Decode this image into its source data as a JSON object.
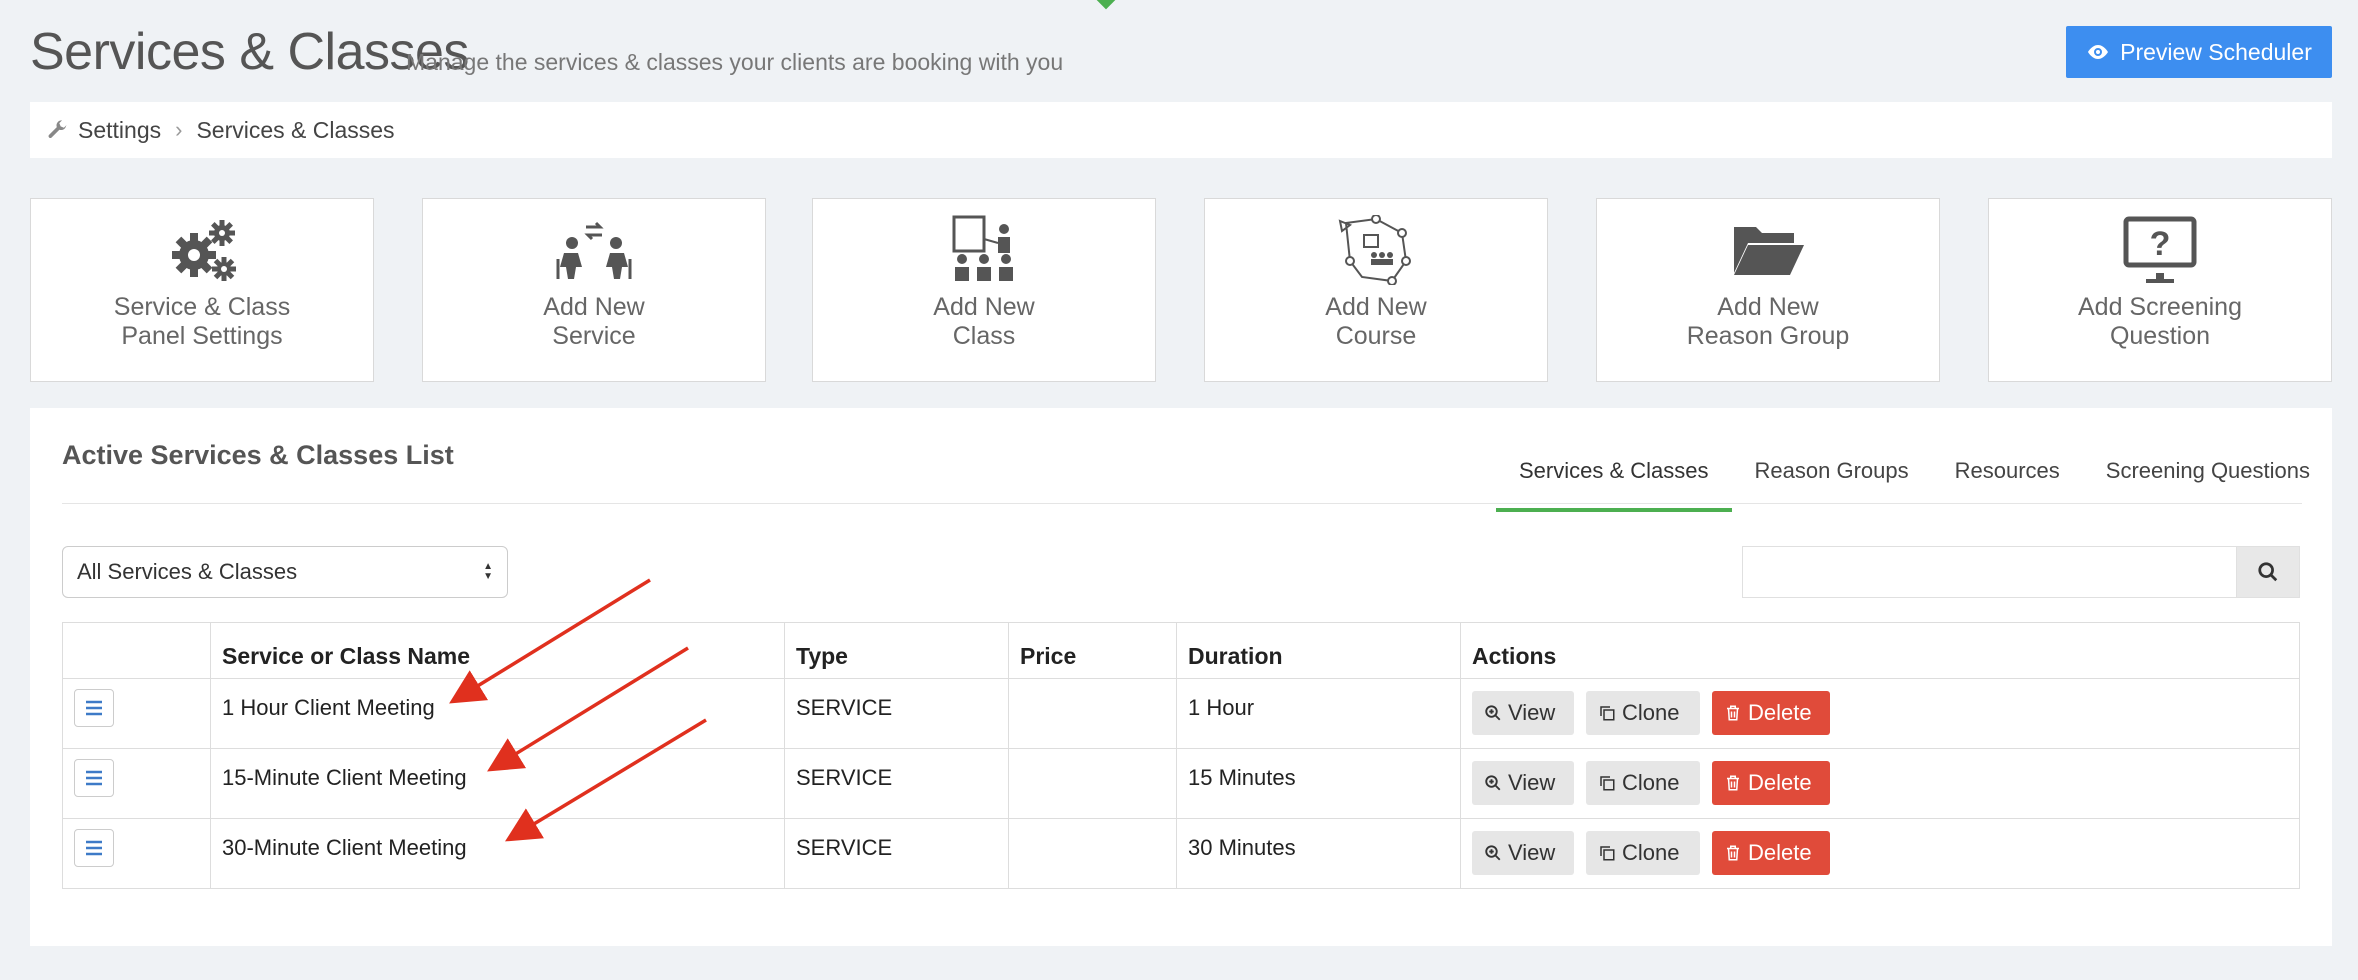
{
  "header": {
    "title": "Services & Classes",
    "subtitle": "Manage the services & classes your clients are booking with you",
    "preview_button": "Preview Scheduler"
  },
  "breadcrumb": {
    "items": [
      "Settings",
      "Services & Classes"
    ]
  },
  "tiles": [
    {
      "label": "Service & Class\nPanel Settings",
      "icon": "gears-icon"
    },
    {
      "label": "Add New\nService",
      "icon": "service-people-icon"
    },
    {
      "label": "Add New\nClass",
      "icon": "class-presentation-icon"
    },
    {
      "label": "Add New\nCourse",
      "icon": "course-network-icon"
    },
    {
      "label": "Add New\nReason Group",
      "icon": "folder-open-icon"
    },
    {
      "label": "Add Screening\nQuestion",
      "icon": "monitor-question-icon"
    }
  ],
  "panel": {
    "title": "Active Services & Classes List",
    "tabs": [
      "Services & Classes",
      "Reason Groups",
      "Resources",
      "Screening Questions"
    ],
    "active_tab": "Services & Classes",
    "filter_value": "All Services & Classes",
    "search_value": ""
  },
  "table": {
    "headers": [
      "",
      "Service or Class Name",
      "Type",
      "Price",
      "Duration",
      "Actions"
    ],
    "rows": [
      {
        "name": "1 Hour Client Meeting",
        "type": "SERVICE",
        "price": "",
        "duration": "1 Hour"
      },
      {
        "name": "15-Minute Client Meeting",
        "type": "SERVICE",
        "price": "",
        "duration": "15 Minutes"
      },
      {
        "name": "30-Minute Client Meeting",
        "type": "SERVICE",
        "price": "",
        "duration": "30 Minutes"
      }
    ],
    "actions": {
      "view": "View",
      "clone": "Clone",
      "delete": "Delete"
    }
  },
  "colors": {
    "primary": "#3d8ef0",
    "active_tab": "#4caf50",
    "delete": "#e04b3a",
    "annotation_arrow": "#e0301e"
  }
}
